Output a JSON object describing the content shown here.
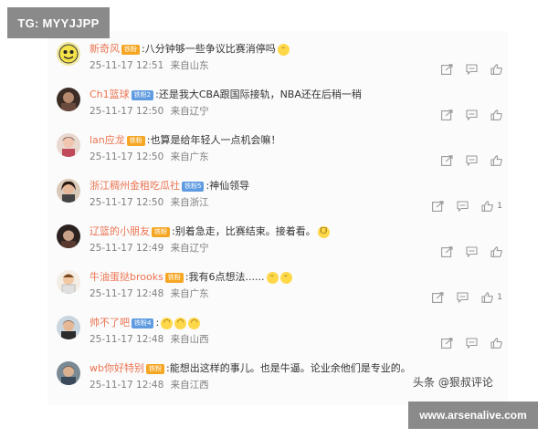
{
  "banners": {
    "top_left": "TG: MYYJJPP",
    "bottom_right": "www.arsenalive.com"
  },
  "watermark": "头条 @狠叔评论",
  "comments": [
    {
      "username": "新奇风",
      "badge": "铁粉",
      "badge_color": "#f5a623",
      "text": ":八分钟够一些争议比赛消停吗",
      "emojis": [
        "smirk-emoji"
      ],
      "date": "25-11-17",
      "time": "12:51",
      "source": "来自山东",
      "likes": ""
    },
    {
      "username": "Ch1篮球",
      "badge": "铁粉2",
      "badge_color": "#5f9be0",
      "text": ":还是我大CBA跟国际接轨，NBA还在后稍一稍",
      "emojis": [],
      "date": "25-11-17",
      "time": "12:50",
      "source": "来自辽宁",
      "likes": ""
    },
    {
      "username": "lan应龙",
      "badge": "铁粉",
      "badge_color": "#f5a623",
      "text": ":也算是给年轻人一点机会嘛！",
      "emojis": [],
      "date": "25-11-17",
      "time": "12:50",
      "source": "来自广东",
      "likes": ""
    },
    {
      "username": "浙江稠州金租吃瓜社",
      "badge": "铁粉5",
      "badge_color": "#5f9be0",
      "text": ":神仙领导",
      "emojis": [],
      "date": "25-11-17",
      "time": "12:50",
      "source": "来自浙江",
      "likes": "1"
    },
    {
      "username": "辽篮的小朋友",
      "badge": "铁粉",
      "badge_color": "#f5a623",
      "text": ":别着急走，比赛结束。接着看。",
      "emojis": [
        "laugh-emoji"
      ],
      "date": "25-11-17",
      "time": "12:49",
      "source": "来自辽宁",
      "likes": ""
    },
    {
      "username": "牛油蛋挞brooks",
      "badge": "铁粉",
      "badge_color": "#f5a623",
      "text": ":我有6点想法......",
      "emojis": [
        "smirk-emoji",
        "smirk-emoji"
      ],
      "date": "25-11-17",
      "time": "12:48",
      "source": "来自广东",
      "likes": "1"
    },
    {
      "username": "帅不了吧",
      "badge": "铁粉4",
      "badge_color": "#5f9be0",
      "text": ":",
      "emojis": [
        "laugh-cry-emoji",
        "laugh-cry-emoji",
        "laugh-cry-emoji"
      ],
      "date": "25-11-17",
      "time": "12:48",
      "source": "来自山西",
      "likes": ""
    },
    {
      "username": "wb你好特别",
      "badge": "铁粉",
      "badge_color": "#f5a623",
      "text": ":能想出这样的事儿。也是牛逼。论业余他们是专业的。",
      "emojis": [],
      "date": "25-11-17",
      "time": "12:48",
      "source": "来自江西",
      "likes": ""
    }
  ],
  "colors": {
    "username": "#eb7350",
    "meta": "#808080",
    "icon": "#9a9a9a"
  }
}
